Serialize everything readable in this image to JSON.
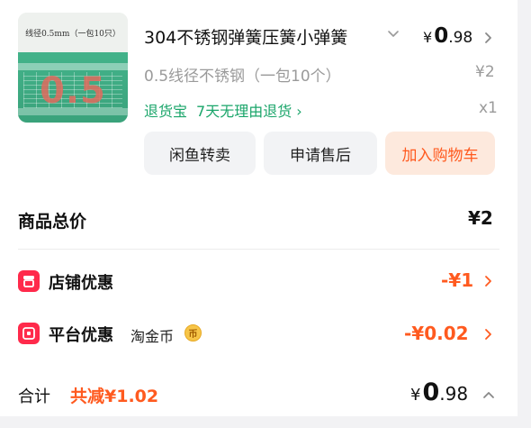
{
  "product": {
    "image": {
      "caption": "线径0.5mm（一包10只）",
      "big_label": "0.5"
    },
    "title": "304不锈钢弹簧压簧小弹簧",
    "price_symbol": "¥",
    "price_int": "0",
    "price_dec": ".98",
    "spec": "0.5线径不锈钢（一包10个）",
    "spec_price": "¥2",
    "guarantee_label": "退货宝",
    "guarantee_text": "7天无理由退货",
    "guarantee_arrow": "›",
    "quantity": "x1"
  },
  "actions": {
    "resell": "闲鱼转卖",
    "after_sale": "申请售后",
    "add_cart": "加入购物车"
  },
  "summary": {
    "total_label": "商品总价",
    "total_value": "¥2",
    "shop_discount_label": "店铺优惠",
    "shop_discount_value": "-¥1",
    "platform_discount_label": "平台优惠",
    "platform_sub": "淘金币",
    "coin_glyph": "币",
    "platform_discount_value": "-¥0.02",
    "sum_label": "合计",
    "saved_label": "共减¥1.02",
    "final_symbol": "¥",
    "final_int": "0",
    "final_dec": ".98"
  },
  "colors": {
    "accent_orange": "#ff5a1f",
    "guarantee_green": "#1aa56a",
    "icon_red": "#ff2a4b"
  }
}
